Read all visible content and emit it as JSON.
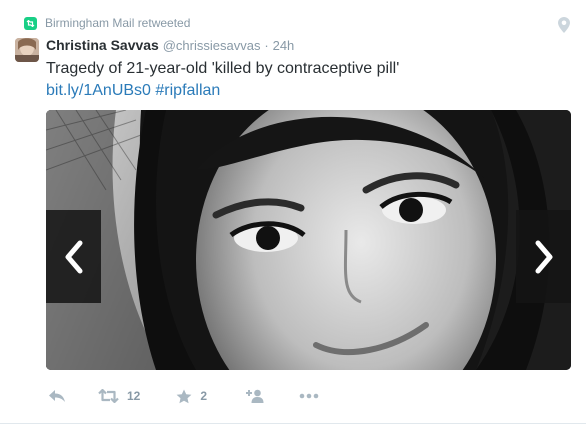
{
  "retweet_banner": {
    "text": "Birmingham Mail retweeted",
    "icon": "retweet-icon"
  },
  "tweet": {
    "author_name": "Christina Savvas",
    "author_handle": "@chrissiesavvas",
    "separator": "·",
    "time": "24h",
    "text": "Tragedy of 21-year-old 'killed by contraceptive pill'",
    "link": "bit.ly/1AnUBs0",
    "hashtag": "#ripfallan"
  },
  "media": {
    "prev_icon": "chevron-left-icon",
    "next_icon": "chevron-right-icon"
  },
  "actions": {
    "reply_icon": "reply-icon",
    "retweet_icon": "retweet-icon",
    "retweet_count": "12",
    "favorite_icon": "star-icon",
    "favorite_count": "2",
    "follow_icon": "follow-icon",
    "more_icon": "more-icon"
  },
  "colors": {
    "retweet_green": "#19cf86",
    "link_blue": "#2b7bb9",
    "muted_gray": "#8899a6",
    "action_gray": "#aab8c2"
  }
}
